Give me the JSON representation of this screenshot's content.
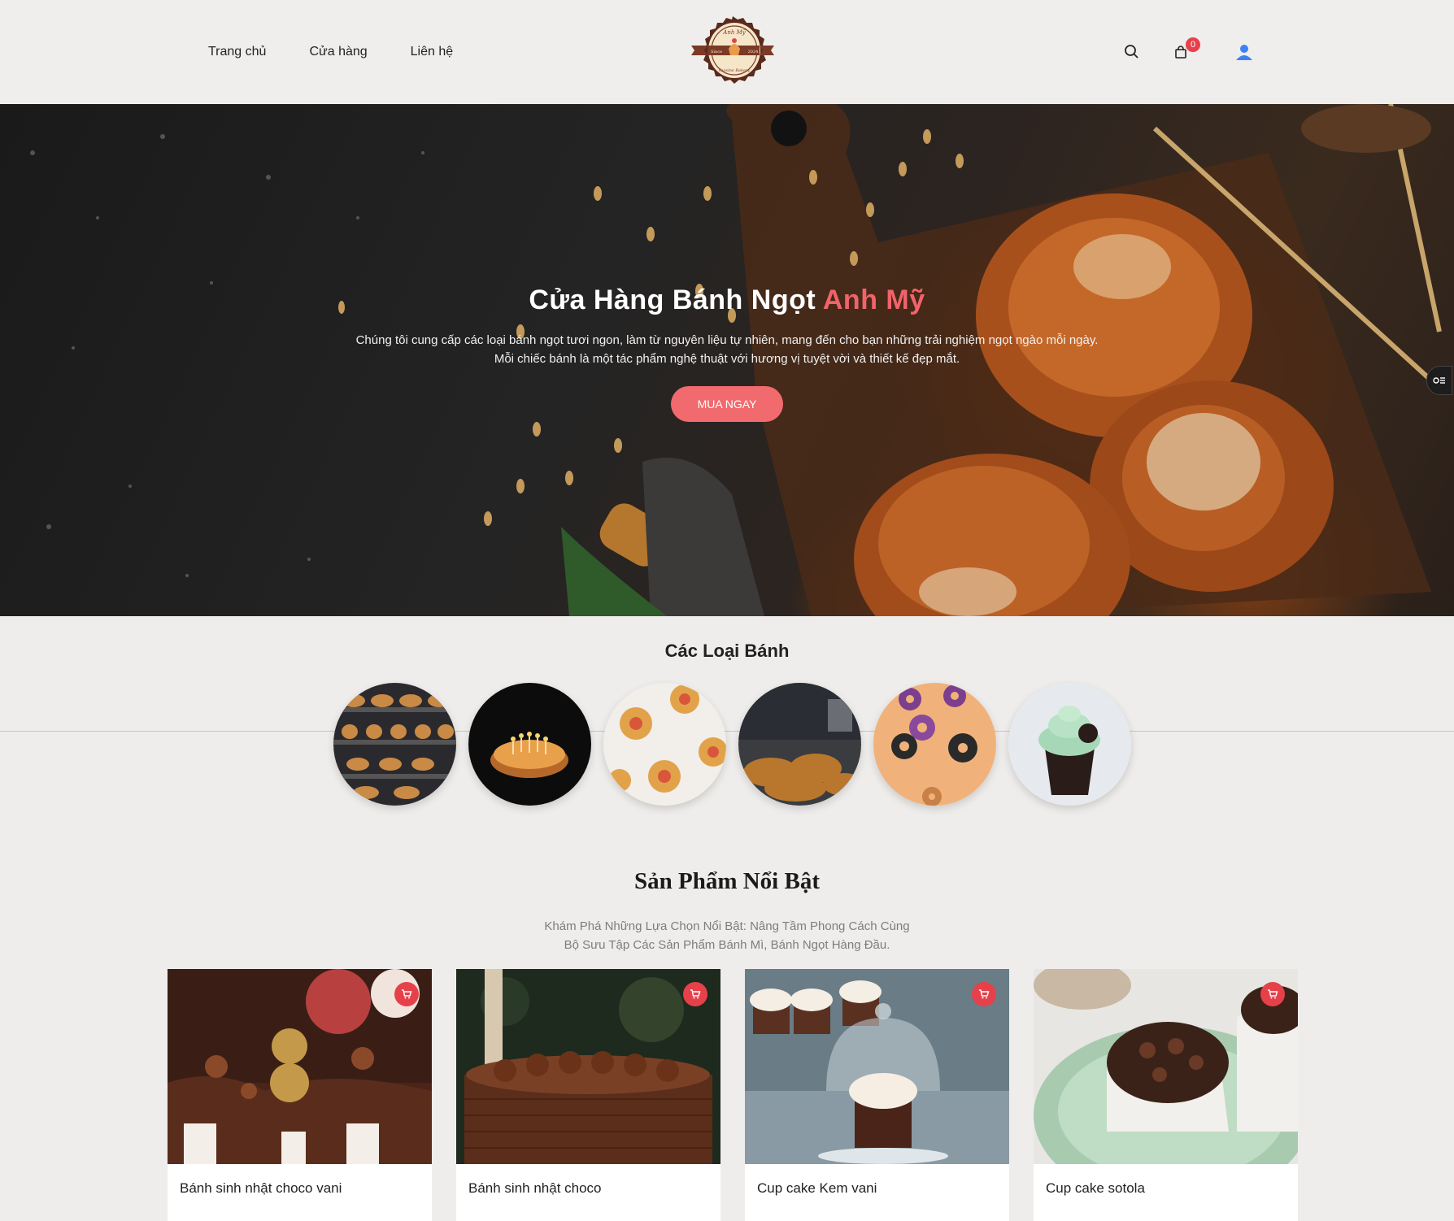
{
  "nav": {
    "items": [
      {
        "label": "Trang chủ"
      },
      {
        "label": "Cửa hàng"
      },
      {
        "label": "Liên hệ"
      }
    ]
  },
  "logo": {
    "top_text": "Anh Mỹ",
    "left_text": "Since",
    "right_text": "2024",
    "bottom_text": "Cuisine Bakery"
  },
  "header": {
    "cart_count": "0",
    "icons": [
      "search-icon",
      "shopping-bag-icon",
      "user-icon"
    ]
  },
  "hero": {
    "title_main": "Cửa Hàng Bánh Ngọt",
    "title_accent": "Anh Mỹ",
    "subtitle_line1": "Chúng tôi cung cấp các loại bánh ngọt tươi ngon, làm từ nguyên liệu tự nhiên, mang đến cho bạn những trải nghiệm ngọt ngào mỗi ngày.",
    "subtitle_line2": "Mỗi chiếc bánh là một tác phẩm nghệ thuật với hương vị tuyệt vời và thiết kế đẹp mắt.",
    "cta_label": "MUA NGAY"
  },
  "categories": {
    "title": "Các Loại Bánh",
    "items": [
      "bread-shelf",
      "birthday-cake",
      "pastry-tart",
      "croissant",
      "donut",
      "cupcake"
    ]
  },
  "featured": {
    "title": "Sản Phẩm Nổi Bật",
    "subtitle_line1": "Khám Phá Những Lựa Chọn Nổi Bật: Nâng Tầm Phong Cách Cùng",
    "subtitle_line2": "Bộ Sưu Tập Các Sản Phẩm Bánh Mì, Bánh Ngọt Hàng Đầu.",
    "products": [
      {
        "name": "Bánh sinh nhật choco vani"
      },
      {
        "name": "Bánh sinh nhật choco"
      },
      {
        "name": "Cup cake Kem vani"
      },
      {
        "name": "Cup cake sotola"
      }
    ]
  },
  "colors": {
    "accent": "#f16a6e",
    "badge": "#e6414b",
    "background": "#efedeb",
    "user_icon": "#3b82f6"
  }
}
